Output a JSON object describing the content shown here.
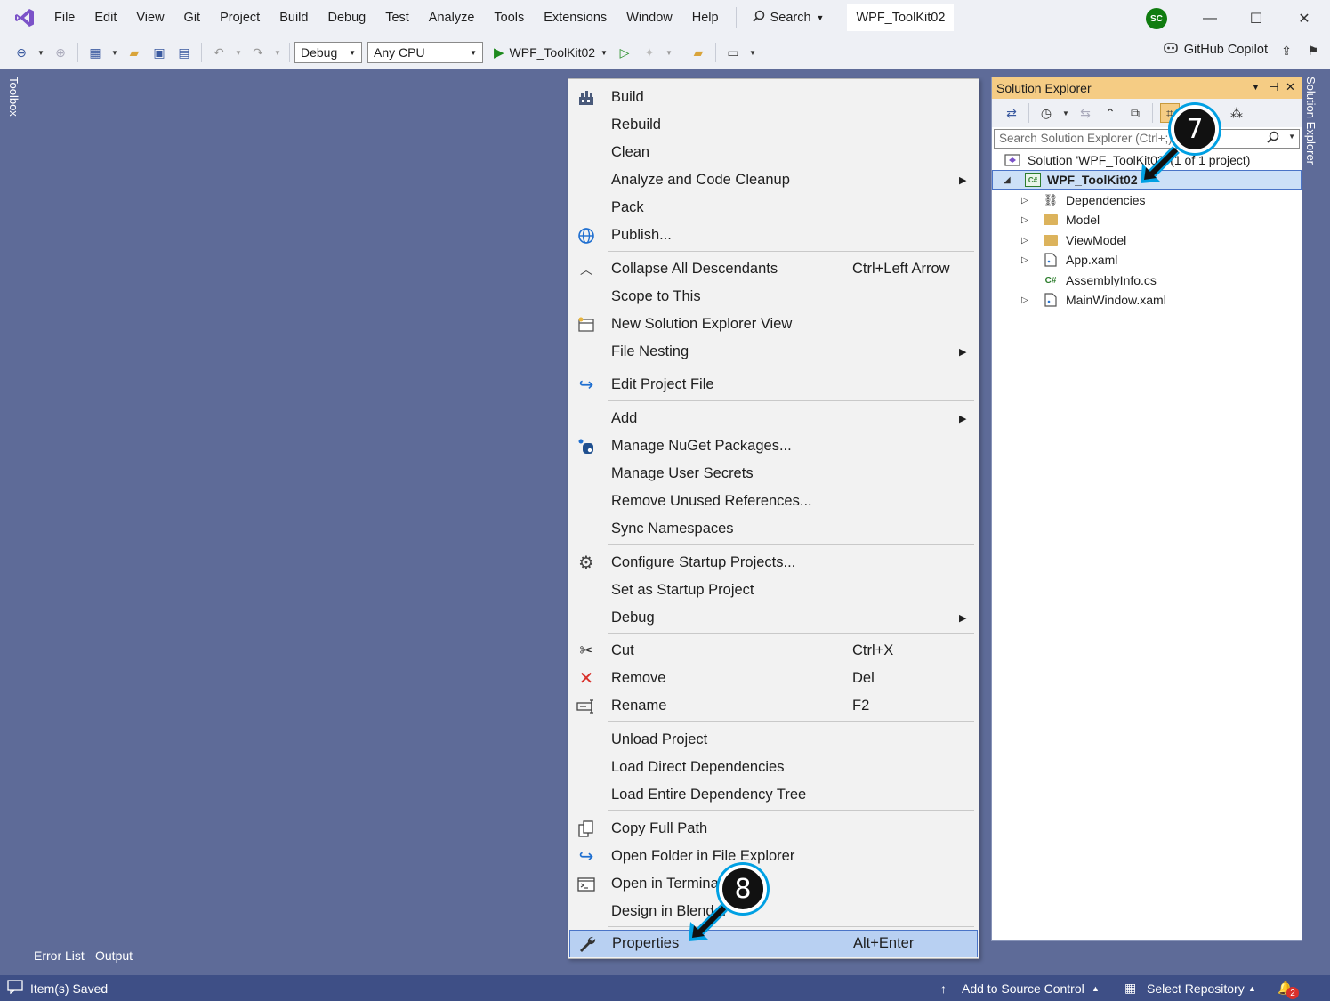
{
  "menubar": {
    "items": [
      "File",
      "Edit",
      "View",
      "Git",
      "Project",
      "Build",
      "Debug",
      "Test",
      "Analyze",
      "Tools",
      "Extensions",
      "Window",
      "Help"
    ],
    "search_label": "Search",
    "window_title": "WPF_ToolKit02",
    "avatar_initials": "SC"
  },
  "toolbar": {
    "config": "Debug",
    "platform": "Any CPU",
    "run_target": "WPF_ToolKit02",
    "copilot_label": "GitHub Copilot"
  },
  "side_tabs": {
    "toolbox": "Toolbox",
    "solution_explorer": "Solution Explorer",
    "error_list": "Error List",
    "output": "Output"
  },
  "context_menu": {
    "items": [
      {
        "label": "Build",
        "icon": "build-icon"
      },
      {
        "label": "Rebuild"
      },
      {
        "label": "Clean"
      },
      {
        "label": "Analyze and Code Cleanup",
        "submenu": true
      },
      {
        "label": "Pack"
      },
      {
        "label": "Publish...",
        "icon": "globe-icon"
      },
      {
        "label": "Collapse All Descendants",
        "shortcut": "Ctrl+Left Arrow",
        "icon": "collapse-icon"
      },
      {
        "label": "Scope to This"
      },
      {
        "label": "New Solution Explorer View",
        "icon": "new-view-icon"
      },
      {
        "label": "File Nesting",
        "submenu": true
      },
      {
        "label": "Edit Project File",
        "icon": "edit-arrow-icon"
      },
      {
        "label": "Add",
        "submenu": true
      },
      {
        "label": "Manage NuGet Packages...",
        "icon": "nuget-icon"
      },
      {
        "label": "Manage User Secrets"
      },
      {
        "label": "Remove Unused References..."
      },
      {
        "label": "Sync Namespaces"
      },
      {
        "label": "Configure Startup Projects...",
        "icon": "gear-icon"
      },
      {
        "label": "Set as Startup Project"
      },
      {
        "label": "Debug",
        "submenu": true
      },
      {
        "label": "Cut",
        "shortcut": "Ctrl+X",
        "icon": "scissors-icon"
      },
      {
        "label": "Remove",
        "shortcut": "Del",
        "icon": "remove-x-icon"
      },
      {
        "label": "Rename",
        "shortcut": "F2",
        "icon": "rename-icon"
      },
      {
        "label": "Unload Project"
      },
      {
        "label": "Load Direct Dependencies"
      },
      {
        "label": "Load Entire Dependency Tree"
      },
      {
        "label": "Copy Full Path",
        "icon": "copy-icon"
      },
      {
        "label": "Open Folder in File Explorer",
        "icon": "open-folder-arrow-icon"
      },
      {
        "label": "Open in Terminal",
        "icon": "terminal-icon"
      },
      {
        "label": "Design in Blend..."
      },
      {
        "label": "Properties",
        "shortcut": "Alt+Enter",
        "icon": "wrench-icon",
        "highlighted": true
      }
    ]
  },
  "solution_explorer": {
    "title": "Solution Explorer",
    "search_placeholder": "Search Solution Explorer (Ctrl+;)",
    "solution_label": "Solution 'WPF_ToolKit02' (1 of 1 project)",
    "project_label": "WPF_ToolKit02",
    "nodes": [
      {
        "label": "Dependencies",
        "icon": "dependencies-icon"
      },
      {
        "label": "Model",
        "icon": "folder-icon"
      },
      {
        "label": "ViewModel",
        "icon": "folder-icon"
      },
      {
        "label": "App.xaml",
        "icon": "xaml-file-icon"
      },
      {
        "label": "AssemblyInfo.cs",
        "icon": "csharp-file-icon"
      },
      {
        "label": "MainWindow.xaml",
        "icon": "xaml-file-icon"
      }
    ]
  },
  "statusbar": {
    "message": "Item(s) Saved",
    "source_control": "Add to Source Control",
    "repository": "Select Repository",
    "notifications": "2"
  },
  "annotations": {
    "step7": "7",
    "step8": "8"
  },
  "colors": {
    "accent_purple": "#7b52c8",
    "workspace": "#5e6b98",
    "statusbar": "#3e4f86",
    "highlight": "#b8d0f2",
    "se_header": "#f5cc84"
  }
}
